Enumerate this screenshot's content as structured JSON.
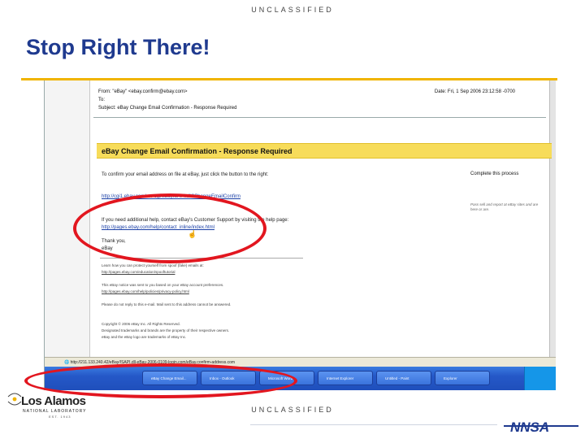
{
  "classification_top": "UNCLASSIFIED",
  "classification_bottom": "UNCLASSIFIED",
  "slide_title": "Stop Right There!",
  "email": {
    "from": "From: \"eBay\" <ebay.confirm@ebay.com>",
    "to": "To:",
    "subject": "Subject: eBay Change Email Confirmation - Response Required",
    "date": "Date: Fri, 1 Sep 2006 23:12:58 -0700",
    "banner": "eBay Change Email Confirmation - Response Required",
    "instruction": "To confirm your email address on file at eBay, just click the button to the right:",
    "confirm_link": "http://cgi1.ebay.com/aw-cgi/eBayISAPI.dll?ChangeEmailConfirm",
    "support_text": "If you need additional help, contact eBay's Customer Support by visiting the help page:",
    "help_link": "http://pages.ebay.com/help/contact_inline/index.html",
    "thanks": "Thank you,",
    "signoff": "eBay",
    "side_heading": "Complete this process",
    "side_note": "Pass sell and report at eBay sites and are here or are.",
    "footer_lines": [
      "Learn how you can protect yourself from spoof (fake) emails at:",
      "http://pages.ebay.com/education/spooftutorial",
      "This eBay notice was sent to you based on your eBay account preferences.",
      "http://pages.ebay.com/help/policies/privacy-policy.html",
      "Please do not reply to this e-mail. Mail sent to this address cannot be answered.",
      "Copyright © 2006 eBay Inc. All Rights Reserved.",
      "Designated trademarks and brands are the property of their respective owners.",
      "eBay and the eBay logo are trademarks of eBay Inc."
    ]
  },
  "status_url": "http://211.133.240.42/eBay/ISAPI.dll-eBay-2006-0109-login.com/eBay.confirm-address.com",
  "taskbar_items": [
    "eBay Change Email...",
    "Inbox - Outlook",
    "Microsoft Word",
    "Internet Explorer",
    "Untitled - Paint",
    "Explorer"
  ],
  "logo_la_name": "Los Alamos",
  "logo_la_sub": "NATIONAL LABORATORY",
  "logo_la_est": "EST. 1943",
  "logo_nnsa": "NNSA",
  "colors": {
    "title": "#1f3a8f",
    "rule": "#f0b400",
    "highlight": "#e2161f",
    "banner": "#f7dc5a",
    "taskbar": "#2558c8"
  }
}
